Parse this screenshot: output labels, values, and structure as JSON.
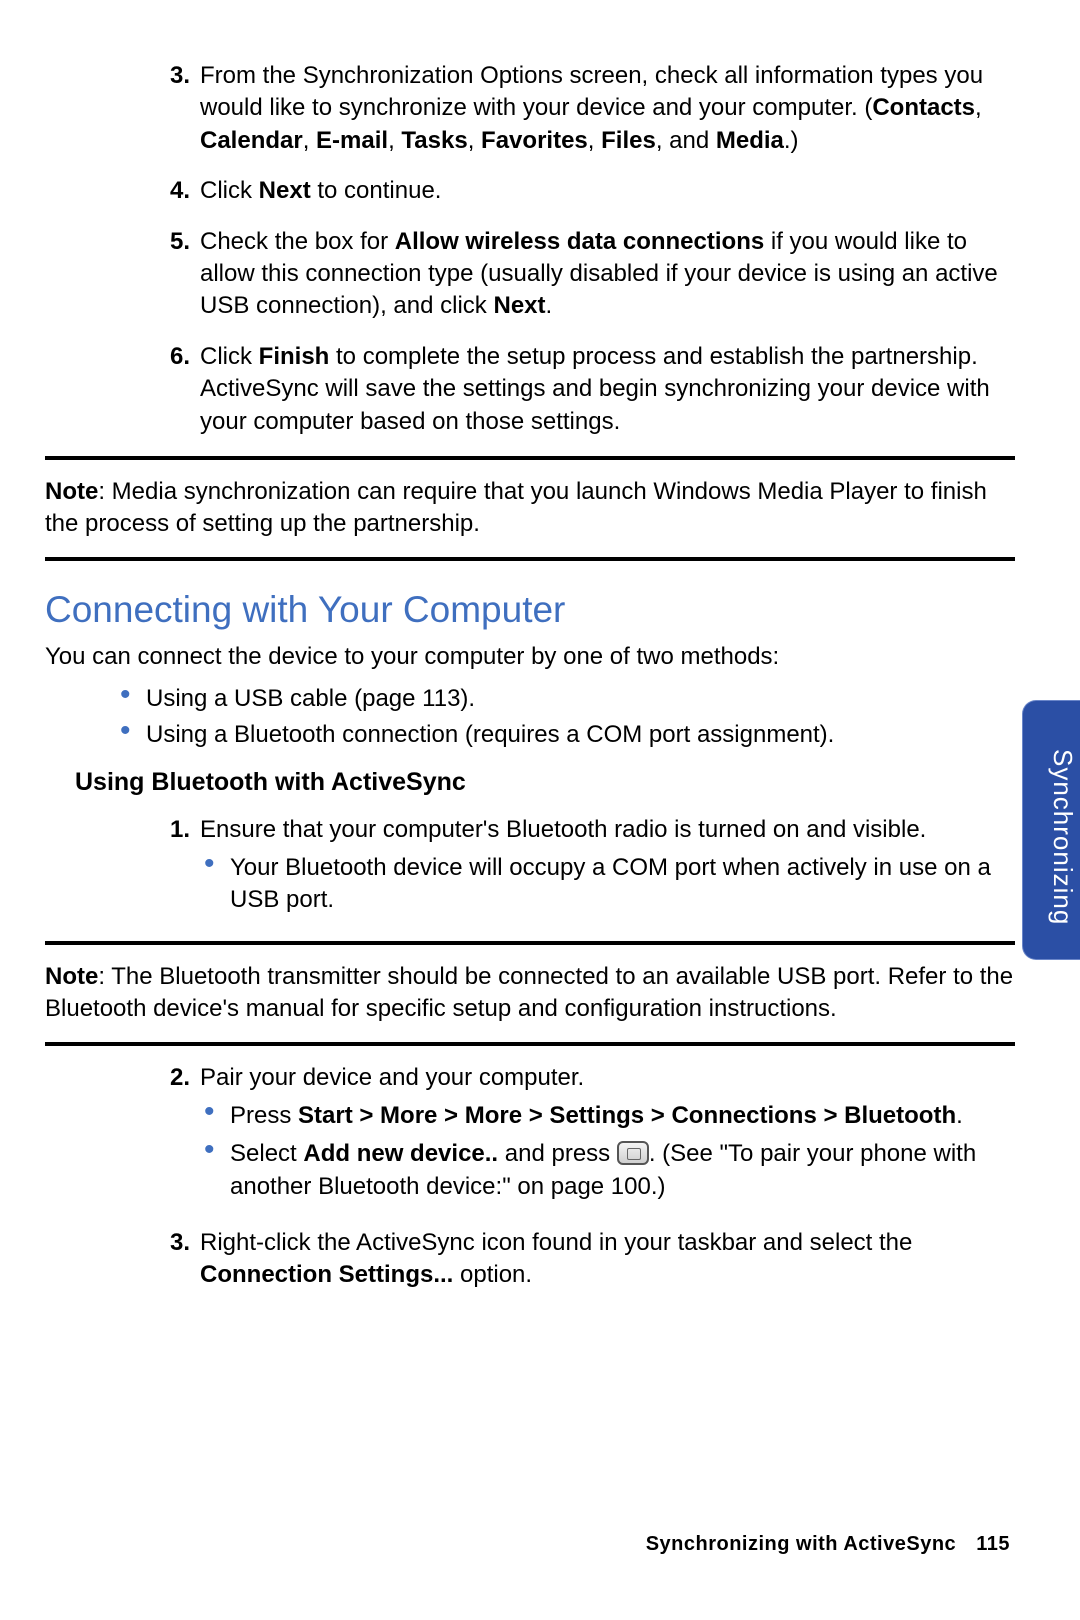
{
  "steps_top": [
    {
      "n": "3.",
      "html": "From the Synchronization Options screen, check all information types you would like to synchronize with your device and your computer. (<b>Contacts</b>, <b>Calendar</b>, <b>E-mail</b>, <b>Tasks</b>, <b>Favorites</b>, <b>Files</b>, and <b>Media</b>.)"
    },
    {
      "n": "4.",
      "html": "Click <b>Next</b> to continue."
    },
    {
      "n": "5.",
      "html": "Check the box for <b>Allow wireless data connections</b> if you would like to allow this connection type (usually disabled if your device is using an active USB connection), and click <b>Next</b>."
    },
    {
      "n": "6.",
      "html": "Click <b>Finish</b> to complete the setup process and establish the partnership. ActiveSync will save the settings and begin synchronizing your device with your computer based on those settings."
    }
  ],
  "note1": {
    "label": "Note",
    "text": ": Media synchronization can require that you launch Windows Media Player to finish the process of setting up the partnership."
  },
  "section_heading": "Connecting with Your Computer",
  "section_intro": "You can connect the device to your computer by one of two methods:",
  "methods": [
    "Using a USB cable (page 113).",
    "Using a Bluetooth connection (requires a COM port assignment)."
  ],
  "subheading": "Using Bluetooth with ActiveSync",
  "bt_step1": {
    "n": "1.",
    "text": "Ensure that your computer's Bluetooth radio is turned on and visible.",
    "sub": [
      "Your Bluetooth device will occupy a COM port when actively in use on a USB port."
    ]
  },
  "note2": {
    "label": "Note",
    "text": ": The Bluetooth transmitter should be connected to an available USB port. Refer to the Bluetooth device's manual for specific setup and configuration instructions."
  },
  "bt_step2": {
    "n": "2.",
    "text": "Pair your device and your computer.",
    "sub": [
      "Press <b>Start > More > More > Settings > Connections > Bluetooth</b>.",
      "Select <b>Add new device..</b> and press <span class=\"btn-icon\" data-name=\"action-button-icon\" data-interactable=\"false\"></span>. (See \"To pair your phone with another Bluetooth device:\" on page 100.)"
    ]
  },
  "bt_step3": {
    "n": "3.",
    "html": "Right-click the ActiveSync icon found in your taskbar and select the <b>Connection Settings...</b> option."
  },
  "side_tab": "Synchronizing",
  "footer": {
    "title": "Synchronizing with ActiveSync",
    "page": "115"
  }
}
